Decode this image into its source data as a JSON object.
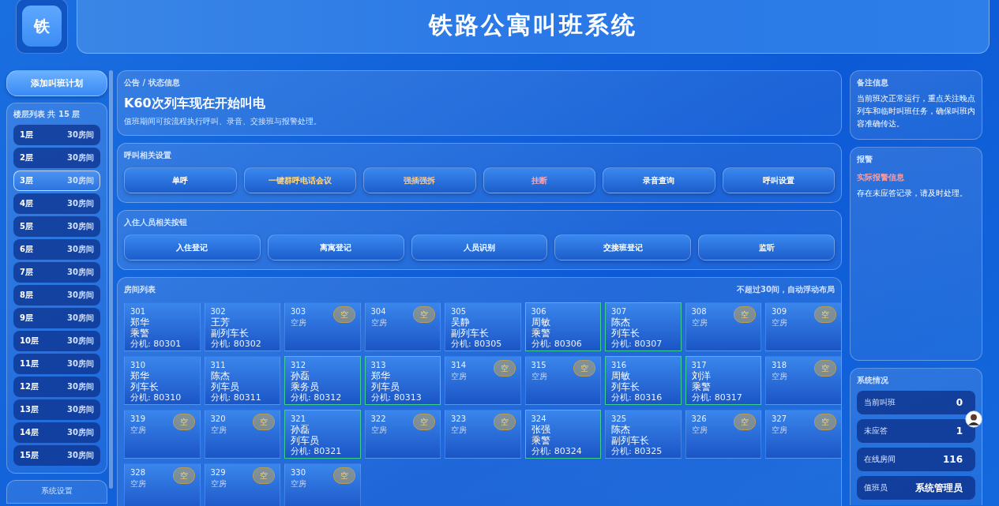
{
  "header": {
    "logo": "铁",
    "title": "铁路公寓叫班系统"
  },
  "sidebar": {
    "add_button": "添加叫班计划",
    "floor_list_title": "楼层列表 共 15 层",
    "floors": [
      {
        "label": "1层",
        "rooms": "30房间",
        "selected": false
      },
      {
        "label": "2层",
        "rooms": "30房间",
        "selected": false
      },
      {
        "label": "3层",
        "rooms": "30房间",
        "selected": true
      },
      {
        "label": "4层",
        "rooms": "30房间",
        "selected": false
      },
      {
        "label": "5层",
        "rooms": "30房间",
        "selected": false
      },
      {
        "label": "6层",
        "rooms": "30房间",
        "selected": false
      },
      {
        "label": "7层",
        "rooms": "30房间",
        "selected": false
      },
      {
        "label": "8层",
        "rooms": "30房间",
        "selected": false
      },
      {
        "label": "9层",
        "rooms": "30房间",
        "selected": false
      },
      {
        "label": "10层",
        "rooms": "30房间",
        "selected": false
      },
      {
        "label": "11层",
        "rooms": "30房间",
        "selected": false
      },
      {
        "label": "12层",
        "rooms": "30房间",
        "selected": false
      },
      {
        "label": "13层",
        "rooms": "30房间",
        "selected": false
      },
      {
        "label": "14层",
        "rooms": "30房间",
        "selected": false
      },
      {
        "label": "15层",
        "rooms": "30房间",
        "selected": false
      }
    ],
    "settings_button": "系统设置"
  },
  "notice": {
    "label": "公告 / 状态信息",
    "headline": "K60次列车现在开始叫电",
    "description": "值班期间可按流程执行呼叫、录音、交接班与报警处理。"
  },
  "call_settings": {
    "title": "呼叫相关设置",
    "buttons": [
      {
        "label": "单呼",
        "color": "#ffffff"
      },
      {
        "label": "一键群呼电话会议",
        "color": "#ffd98a"
      },
      {
        "label": "强插强拆",
        "color": "#ffc98a"
      },
      {
        "label": "挂断",
        "color": "#ffa4b4"
      },
      {
        "label": "录音查询",
        "color": "#ffffff"
      },
      {
        "label": "呼叫设置",
        "color": "#ffffff"
      }
    ]
  },
  "resident_buttons": {
    "title": "入住人员相关按钮",
    "buttons": [
      "入住登记",
      "离寓登记",
      "人员识别",
      "交接班登记",
      "监听"
    ]
  },
  "room_list": {
    "title": "房间列表",
    "note": "不超过30间，自动浮动布局",
    "rooms": [
      {
        "kind": "occupied",
        "number": "301",
        "name": "郑华",
        "role": "乘警",
        "extension": "分机: 80301",
        "highlighted": false
      },
      {
        "kind": "occupied",
        "number": "302",
        "name": "王芳",
        "role": "副列车长",
        "extension": "分机: 80302",
        "highlighted": false
      },
      {
        "kind": "vacant",
        "number": "303",
        "status": "空房",
        "badge": "空"
      },
      {
        "kind": "vacant",
        "number": "304",
        "status": "空房",
        "badge": "空"
      },
      {
        "kind": "occupied",
        "number": "305",
        "name": "吴静",
        "role": "副列车长",
        "extension": "分机: 80305",
        "highlighted": false
      },
      {
        "kind": "occupied",
        "number": "306",
        "name": "周敏",
        "role": "乘警",
        "extension": "分机: 80306",
        "highlighted": true
      },
      {
        "kind": "occupied",
        "number": "307",
        "name": "陈杰",
        "role": "列车长",
        "extension": "分机: 80307",
        "highlighted": true
      },
      {
        "kind": "vacant",
        "number": "308",
        "status": "空房",
        "badge": "空"
      },
      {
        "kind": "vacant",
        "number": "309",
        "status": "空房",
        "badge": "空"
      },
      {
        "kind": "occupied",
        "number": "310",
        "name": "郑华",
        "role": "列车长",
        "extension": "分机: 80310",
        "highlighted": false
      },
      {
        "kind": "occupied",
        "number": "311",
        "name": "陈杰",
        "role": "列车员",
        "extension": "分机: 80311",
        "highlighted": false
      },
      {
        "kind": "occupied",
        "number": "312",
        "name": "孙磊",
        "role": "乘务员",
        "extension": "分机: 80312",
        "highlighted": true
      },
      {
        "kind": "occupied",
        "number": "313",
        "name": "郑华",
        "role": "列车员",
        "extension": "分机: 80313",
        "highlighted": true
      },
      {
        "kind": "vacant",
        "number": "314",
        "status": "空房",
        "badge": "空"
      },
      {
        "kind": "vacant",
        "number": "315",
        "status": "空房",
        "badge": "空"
      },
      {
        "kind": "occupied",
        "number": "316",
        "name": "周敏",
        "role": "列车长",
        "extension": "分机: 80316",
        "highlighted": true
      },
      {
        "kind": "occupied",
        "number": "317",
        "name": "刘洋",
        "role": "乘警",
        "extension": "分机: 80317",
        "highlighted": true
      },
      {
        "kind": "vacant",
        "number": "318",
        "status": "空房",
        "badge": "空"
      },
      {
        "kind": "vacant",
        "number": "319",
        "status": "空房",
        "badge": "空"
      },
      {
        "kind": "vacant",
        "number": "320",
        "status": "空房",
        "badge": "空"
      },
      {
        "kind": "occupied",
        "number": "321",
        "name": "孙磊",
        "role": "列车员",
        "extension": "分机: 80321",
        "highlighted": true
      },
      {
        "kind": "vacant",
        "number": "322",
        "status": "空房",
        "badge": "空"
      },
      {
        "kind": "vacant",
        "number": "323",
        "status": "空房",
        "badge": "空"
      },
      {
        "kind": "occupied",
        "number": "324",
        "name": "张强",
        "role": "乘警",
        "extension": "分机: 80324",
        "highlighted": true
      },
      {
        "kind": "occupied",
        "number": "325",
        "name": "陈杰",
        "role": "副列车长",
        "extension": "分机: 80325",
        "highlighted": false
      },
      {
        "kind": "vacant",
        "number": "326",
        "status": "空房",
        "badge": "空"
      },
      {
        "kind": "vacant",
        "number": "327",
        "status": "空房",
        "badge": "空"
      },
      {
        "kind": "vacant",
        "number": "328",
        "status": "空房",
        "badge": "空"
      },
      {
        "kind": "vacant",
        "number": "329",
        "status": "空房",
        "badge": "空"
      },
      {
        "kind": "vacant",
        "number": "330",
        "status": "空房",
        "badge": "空"
      }
    ]
  },
  "remarks": {
    "title": "备注信息",
    "text": "当前班次正常运行，重点关注晚点列车和临时叫班任务，确保叫班内容准确传达。"
  },
  "alarm": {
    "title": "报警",
    "headline": "实际报警信息",
    "text": "存在未应答记录，请及时处理。"
  },
  "system_status": {
    "title": "系统情况",
    "stats": [
      {
        "label": "当前叫班",
        "value": "0"
      },
      {
        "label": "未应答",
        "value": "1"
      },
      {
        "label": "在线房间",
        "value": "116"
      },
      {
        "label": "值班员",
        "value": "系统管理员"
      }
    ]
  }
}
